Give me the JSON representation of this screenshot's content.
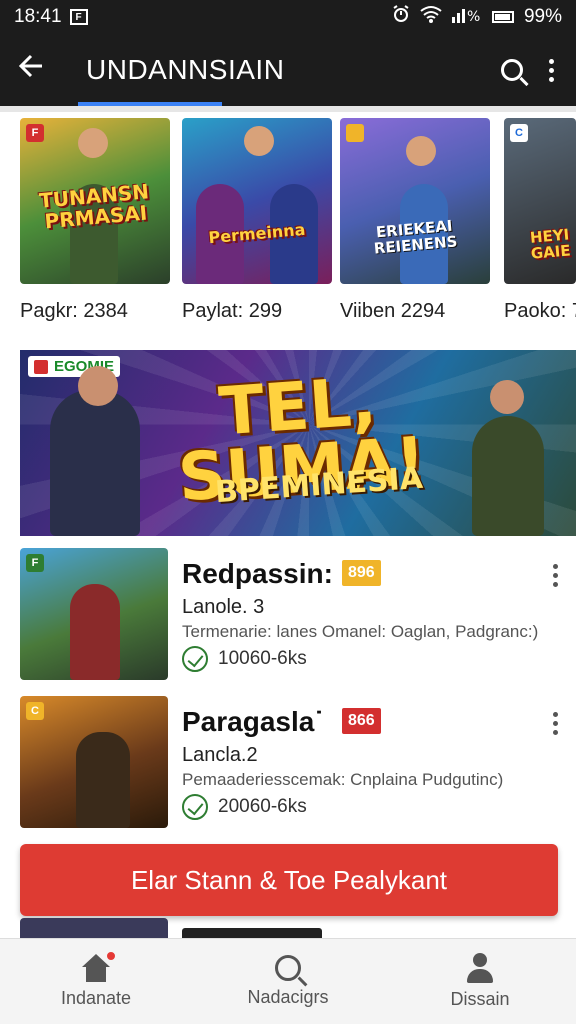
{
  "status_bar": {
    "time": "18:41",
    "battery": "99%",
    "notification_glyph": "F"
  },
  "app_bar": {
    "title": "UNDANNSIAIN"
  },
  "tiles": [
    {
      "cover_text": "TUNANSN PRMASAI",
      "label": "Pagkr: 2384",
      "badge": "F"
    },
    {
      "cover_text": "Permeinna",
      "label": "Paylat: 299",
      "badge": ""
    },
    {
      "cover_text": "ERIEKEAI REIENENS",
      "label": "Viiben 2294",
      "badge": ""
    },
    {
      "cover_text": "HEYI GAIE",
      "label": "Paoko: 7",
      "badge": "C"
    }
  ],
  "hero": {
    "logo_text": "EGOMIE",
    "headline": "TEL, SUMA!",
    "subline": "BPEMINESIA"
  },
  "list_items": [
    {
      "name": "Redpassin:",
      "tag": "896",
      "subtitle": "Lanole. 3",
      "description": "Termenarie: lanes Omanel: Oaglan, Padgranc:)",
      "size": "10060-6ks",
      "badge": "F"
    },
    {
      "name": "Paragasla˙",
      "tag": "866",
      "subtitle": "Lancla.2",
      "description": "Pemaaderiesscemak: Cnplaina Pudgutinc)",
      "size": "20060-6ks",
      "badge": "C"
    }
  ],
  "cta": {
    "label": "Elar Stann & Toe Pealykant"
  },
  "bottom_nav": [
    {
      "label": "Indanate",
      "icon": "home-icon"
    },
    {
      "label": "Nadacigrs",
      "icon": "search-icon"
    },
    {
      "label": "Dissain",
      "icon": "person-icon"
    }
  ],
  "colors": {
    "app_bar": "#1c1c1c",
    "tab_indicator": "#3b82f6",
    "cta": "#de3b33",
    "tag_yellow": "#f0b429",
    "tag_red": "#d32f2f",
    "check_green": "#2e7d32"
  }
}
